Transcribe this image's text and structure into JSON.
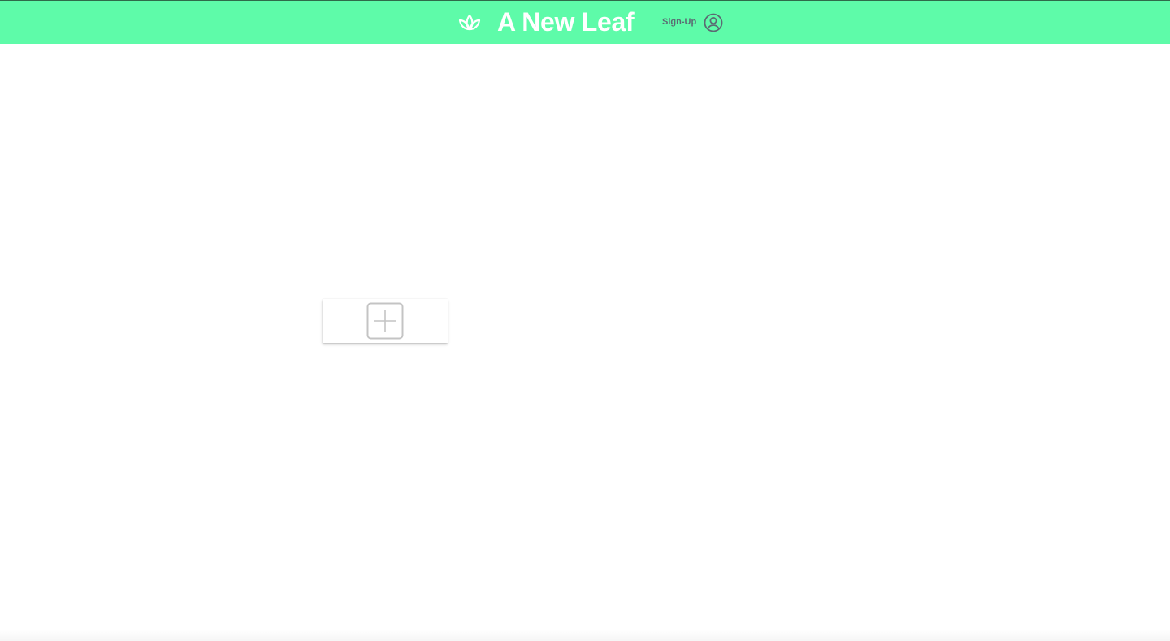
{
  "header": {
    "brand_title": "A New Leaf",
    "signup_label": "Sign-Up",
    "logo_icon": "lotus-leaf-icon",
    "user_icon": "user-circle-icon",
    "background_color": "#5efba9"
  },
  "main": {
    "add_card": {
      "icon": "plus-square-icon"
    }
  }
}
